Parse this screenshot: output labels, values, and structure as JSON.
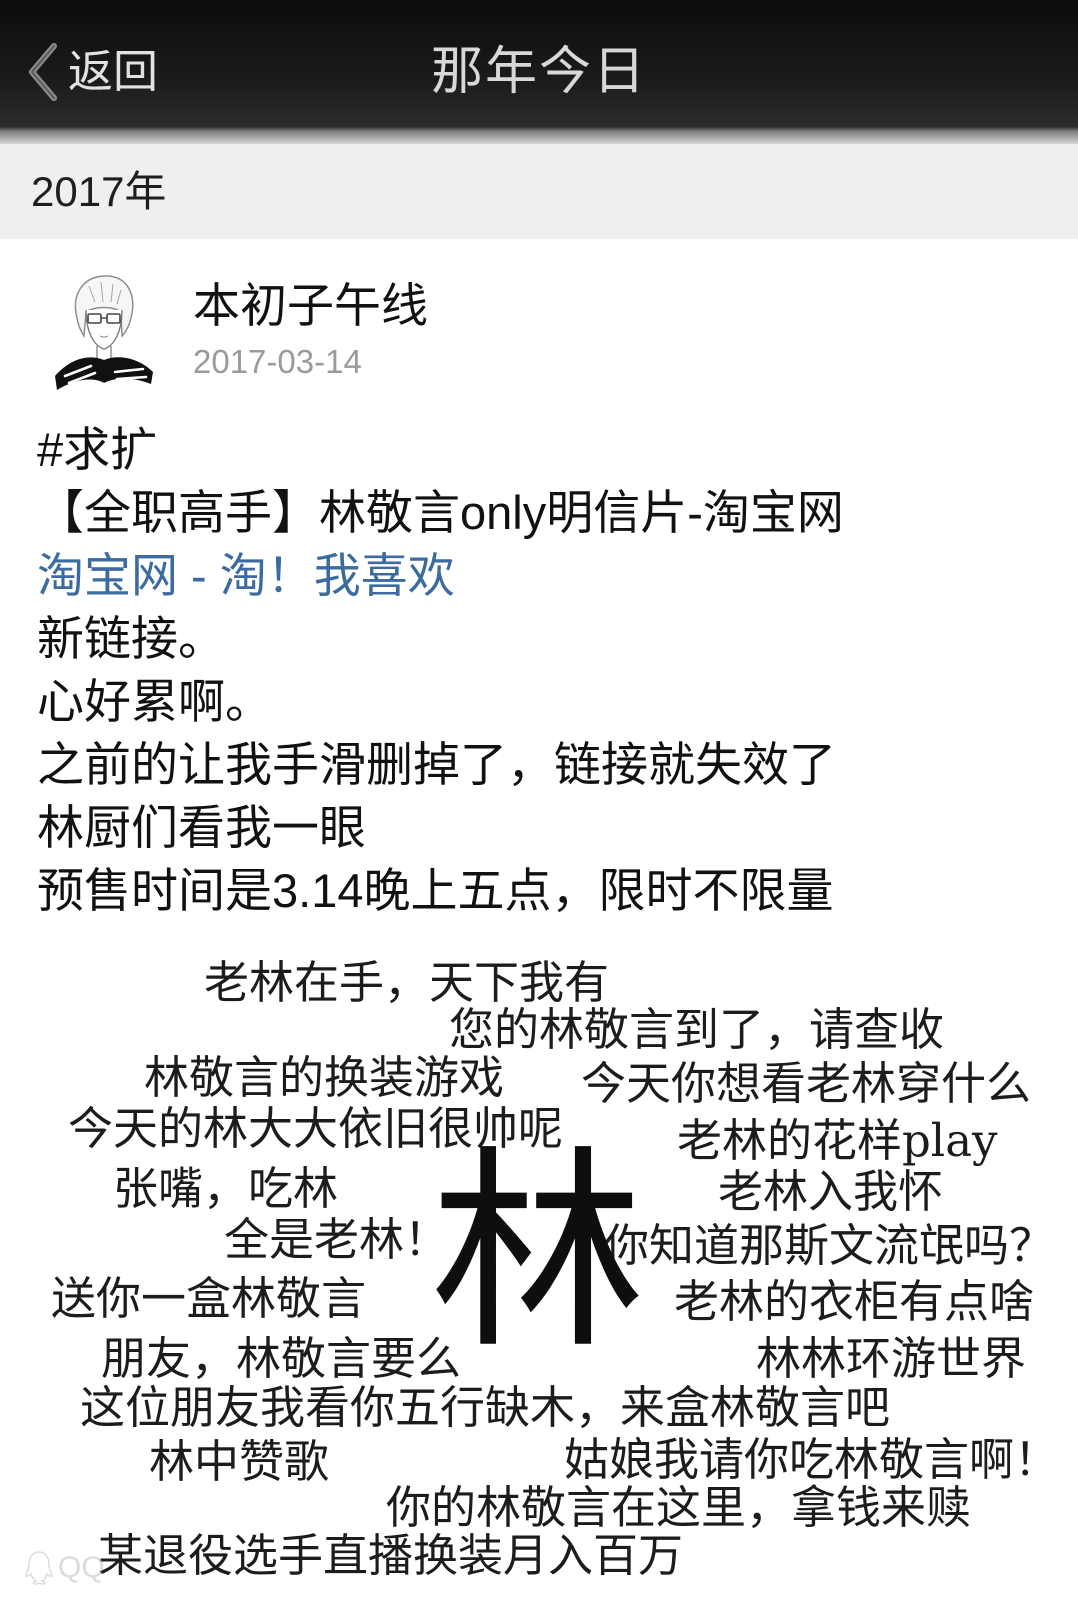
{
  "nav": {
    "back_label": "返回",
    "title": "那年今日"
  },
  "year_header": {
    "label": "2017年"
  },
  "post": {
    "author": "本初子午线",
    "date": "2017-03-14",
    "hashtag": "#求扩",
    "share_title": "【全职高手】林敬言only明信片-淘宝网",
    "share_link": "淘宝网 - 淘！我喜欢",
    "lines": [
      "新链接。",
      "心好累啊。",
      "之前的让我手滑删掉了，链接就失效了",
      "林厨们看我一眼",
      "预售时间是3.14晚上五点，限时不限量"
    ]
  },
  "post_image": {
    "center_char": "林",
    "phrases": [
      "老林在手，天下我有",
      "您的林敬言到了，请查收",
      "林敬言的换装游戏",
      "今天你想看老林穿什么",
      "今天的林大大依旧很帅呢",
      "老林的花样play",
      "张嘴，吃林",
      "老林入我怀",
      "全是老林！",
      "你知道那斯文流氓吗？",
      "送你一盒林敬言",
      "老林的衣柜有点啥",
      "朋友，林敬言要么",
      "林林环游世界",
      "这位朋友我看你五行缺木，来盒林敬言吧",
      "林中赞歌",
      "姑娘我请你吃林敬言啊！",
      "你的林敬言在这里，拿钱来赎",
      "某退役选手直播换装月入百万"
    ],
    "watermark": "QQ"
  },
  "icons": {
    "back": "chevron-left-icon",
    "watermark_logo": "qq-logo-icon"
  },
  "colors": {
    "nav_background": "#1b1b1b",
    "year_header_background": "#efefef",
    "link": "#3b6ba0",
    "date_text": "#9a9a9a",
    "body_text": "#111111"
  }
}
